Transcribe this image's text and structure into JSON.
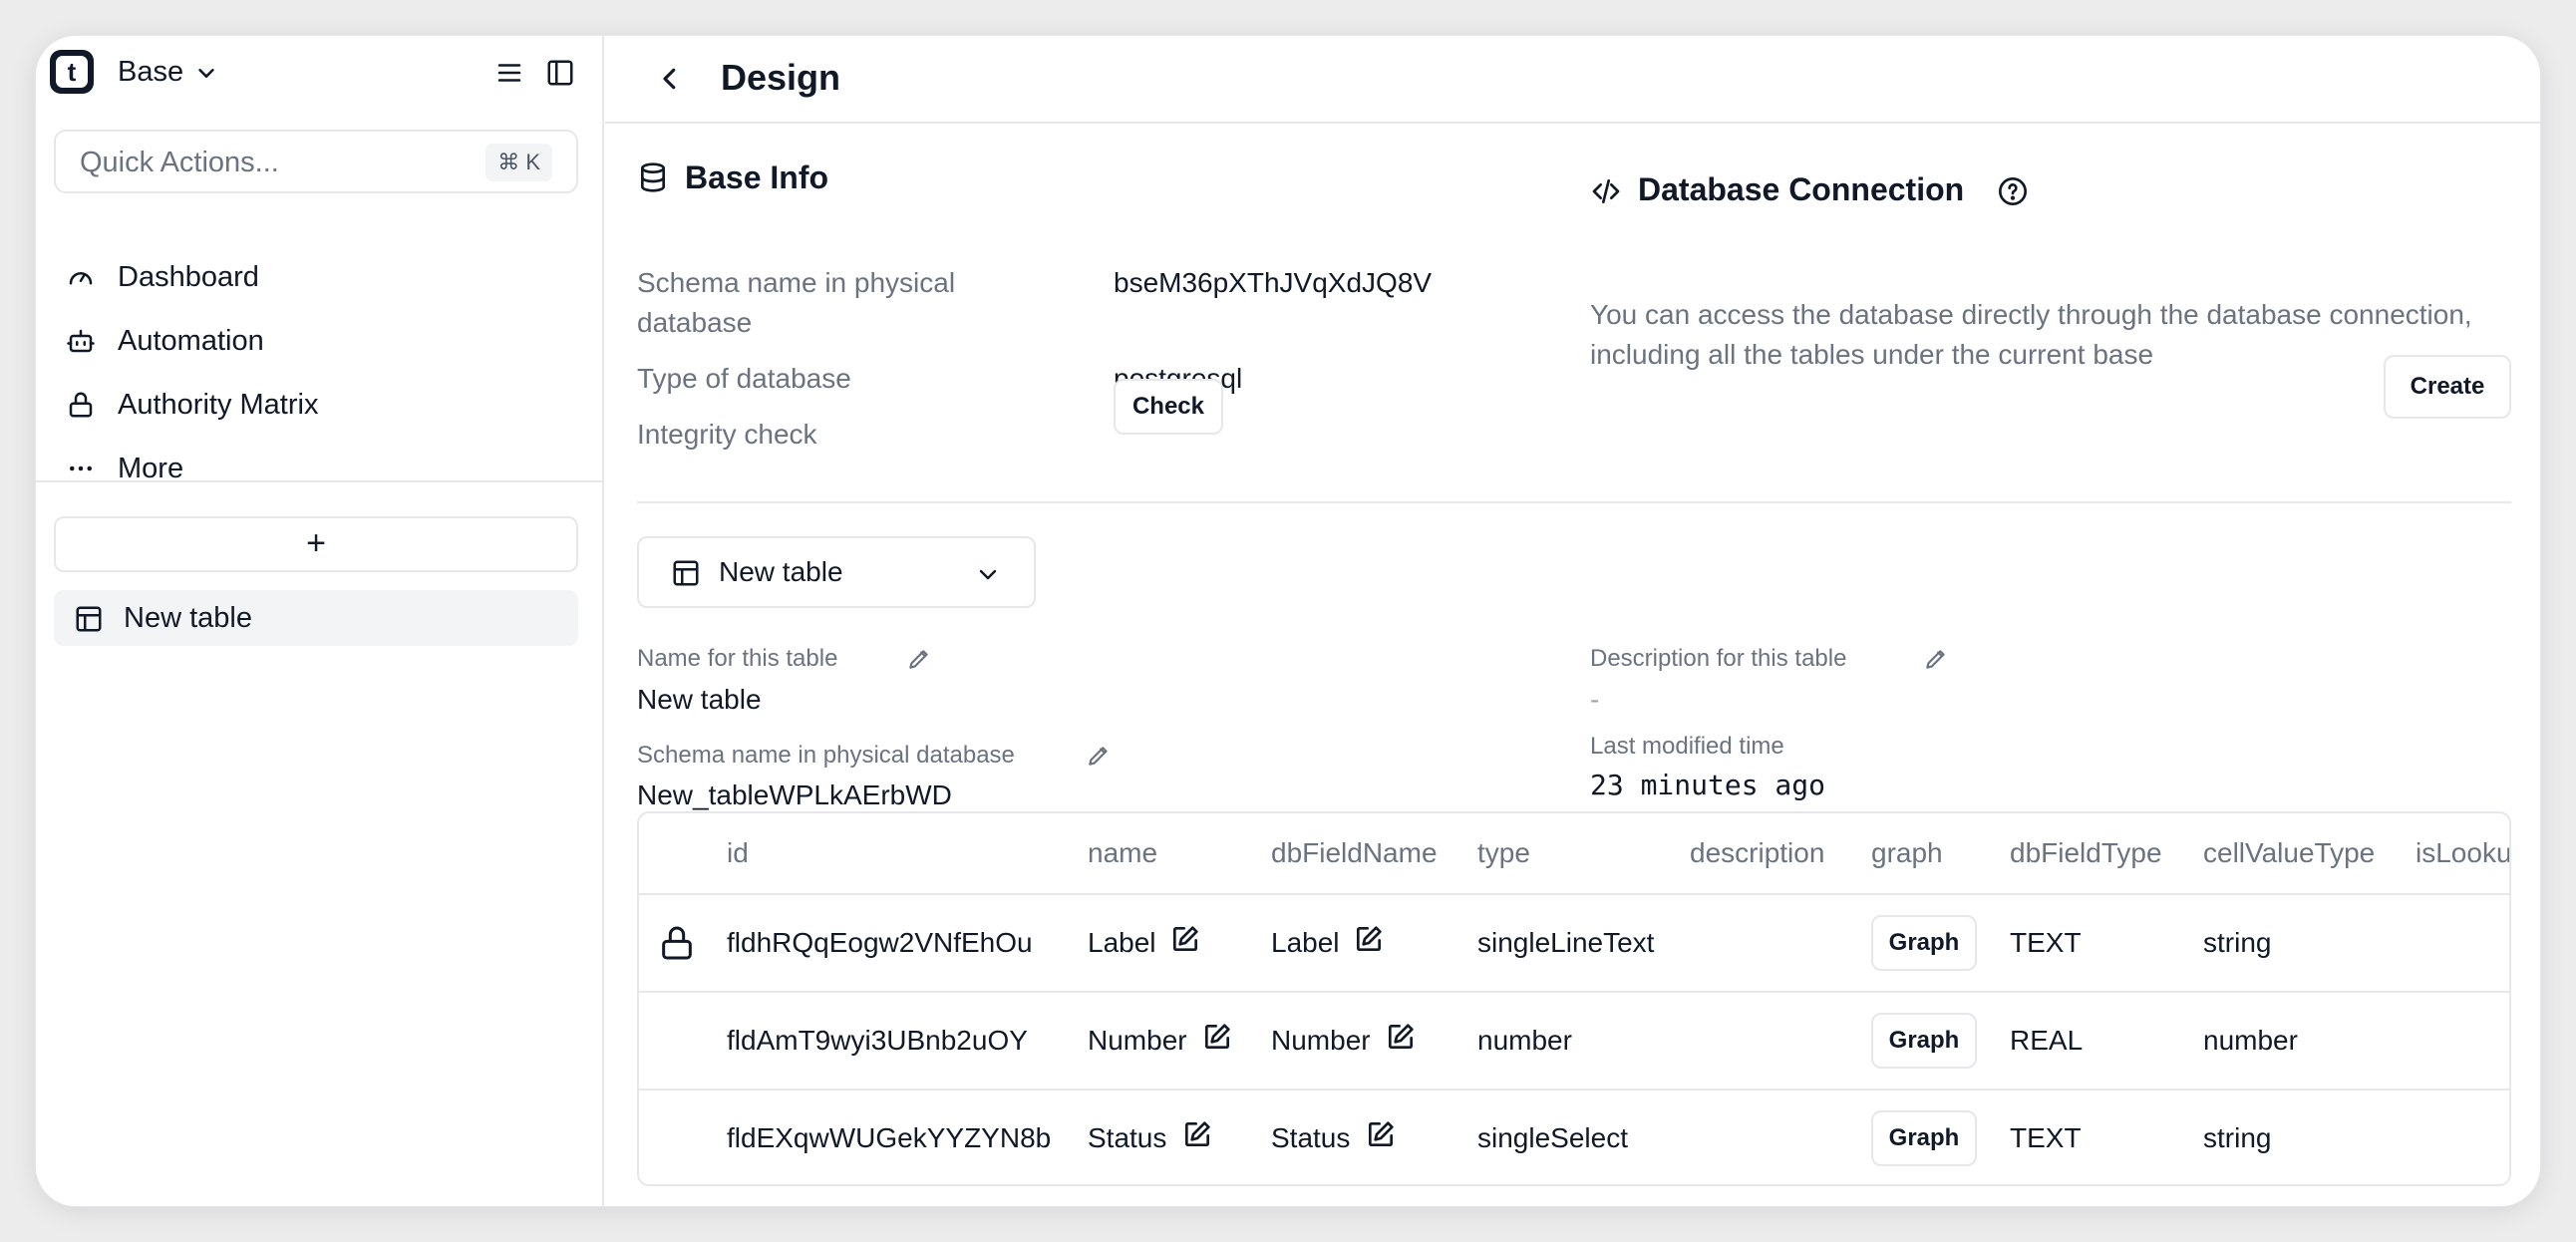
{
  "sidebar": {
    "logo_letter": "t",
    "base_name": "Base",
    "quick_actions": {
      "placeholder": "Quick Actions...",
      "shortcut": "⌘ K"
    },
    "nav": [
      {
        "label": "Dashboard",
        "icon": "gauge-icon"
      },
      {
        "label": "Automation",
        "icon": "robot-icon"
      },
      {
        "label": "Authority Matrix",
        "icon": "lock-icon"
      },
      {
        "label": "More",
        "icon": "more-icon"
      }
    ],
    "add_label": "+",
    "tables": [
      {
        "label": "New table",
        "icon": "table-icon"
      }
    ]
  },
  "header": {
    "title": "Design"
  },
  "base_info": {
    "title": "Base Info",
    "schema_label": "Schema name in physical database",
    "schema_value": "bseM36pXThJVqXdJQ8V",
    "db_type_label": "Type of database",
    "db_type_value": "postgresql",
    "integrity_label": "Integrity check",
    "check_button": "Check"
  },
  "db_connection": {
    "title": "Database Connection",
    "description": "You can access the database directly through the database connection, including all the tables under the current base",
    "create_button": "Create"
  },
  "table_select": {
    "value": "New table"
  },
  "table_info": {
    "name_label": "Name for this table",
    "name_value": "New table",
    "schema_label": "Schema name in physical database",
    "schema_value": "New_tableWPLkAErbWD",
    "description_label": "Description for this table",
    "description_value": "-",
    "modified_label": "Last modified time",
    "modified_value": "23 minutes ago"
  },
  "fields_table": {
    "columns": [
      "id",
      "name",
      "dbFieldName",
      "type",
      "description",
      "graph",
      "dbFieldType",
      "cellValueType",
      "isLookup"
    ],
    "rows": [
      {
        "locked": true,
        "id": "fldhRQqEogw2VNfEhOu",
        "name": "Label",
        "dbFieldName": "Label",
        "type": "singleLineText",
        "description": "",
        "graph": "Graph",
        "dbFieldType": "TEXT",
        "cellValueType": "string"
      },
      {
        "locked": false,
        "id": "fldAmT9wyi3UBnb2uOY",
        "name": "Number",
        "dbFieldName": "Number",
        "type": "number",
        "description": "",
        "graph": "Graph",
        "dbFieldType": "REAL",
        "cellValueType": "number"
      },
      {
        "locked": false,
        "id": "fldEXqwWUGekYYZYN8b",
        "name": "Status",
        "dbFieldName": "Status",
        "type": "singleSelect",
        "description": "",
        "graph": "Graph",
        "dbFieldType": "TEXT",
        "cellValueType": "string"
      }
    ]
  }
}
